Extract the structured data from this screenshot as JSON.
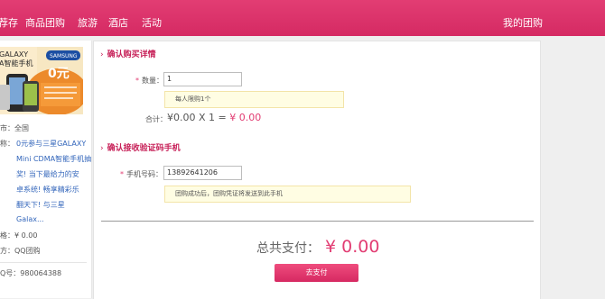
{
  "nav": {
    "items": [
      "荐存",
      "商品团购",
      "旅游",
      "酒店",
      "活动"
    ],
    "my_groupbuy": "我的团购"
  },
  "sidebar": {
    "product_image": {
      "brand_text": "GALAXY",
      "sub_text": "A智能手机",
      "banner_text": "0元",
      "samsung_logo": "SAMSUNG"
    },
    "city": "市：全国",
    "name_label": "称：",
    "name_lines": [
      "0元参与三星GALAXY",
      "Mini CDMA智能手机抽",
      "奖! 当下最给力的安",
      "卓系统! 畅享精彩乐",
      "翻天下! 与三星",
      "Galax..."
    ],
    "price": "格：¥ 0.00",
    "vendor": "方：QQ团购",
    "qq": "Q号：980064388"
  },
  "section1": {
    "title": "确认购买详情",
    "quantity_label": "数量：",
    "quantity_value": "1",
    "quantity_note": "每人限购1个",
    "subtotal_label": "合计：",
    "subtotal_formula": "¥0.00 X 1 = ",
    "subtotal_result": "¥ 0.00"
  },
  "section2": {
    "title": "确认接收验证码手机",
    "phone_label": "手机号码：",
    "phone_value": "13892641206",
    "phone_note": "团购成功后，团购凭证将发送到此手机"
  },
  "total": {
    "label": "总共支付：",
    "amount": "¥ 0.00",
    "pay_button": "去支付"
  },
  "colors": {
    "brand": "#e23d73",
    "section_title": "#c72058",
    "note_bg": "#fffde3"
  }
}
